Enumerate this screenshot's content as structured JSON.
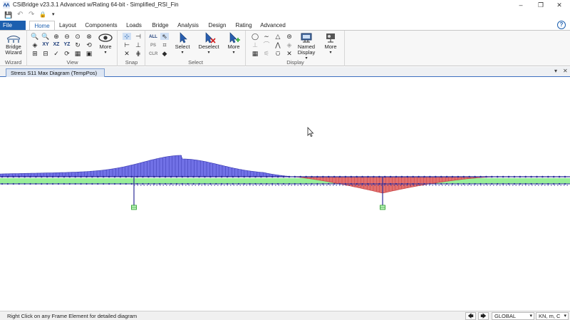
{
  "window": {
    "title": "CSiBridge v23.3.1 Advanced w/Rating 64-bit - Simplified_RSI_Fin",
    "minimize": "–",
    "restore": "❐",
    "close": "✕"
  },
  "quick_access": {
    "save": "💾",
    "undo": "↶",
    "redo": "↷",
    "lock": "🔒",
    "more": "▾"
  },
  "ribbon_tabs": {
    "file": "File",
    "items": [
      "Home",
      "Layout",
      "Components",
      "Loads",
      "Bridge",
      "Analysis",
      "Design",
      "Rating",
      "Advanced"
    ],
    "active": "Home",
    "help": "?"
  },
  "ribbon": {
    "bridge_wizard": {
      "label": "Bridge Wizard",
      "group": "Wizard"
    },
    "view": {
      "group": "View",
      "xy": "XY",
      "xz": "XZ",
      "yz": "YZ",
      "more": "More"
    },
    "snap": {
      "group": "Snap"
    },
    "select": {
      "group": "Select",
      "all": "ALL",
      "ps": "PS",
      "clr": "CLR",
      "select": "Select",
      "deselect": "Deselect",
      "more": "More"
    },
    "display": {
      "group": "Display",
      "named_display": "Named Display",
      "more": "More"
    }
  },
  "document": {
    "tab_title": "Stress S11 Max Diagram (TempPos)",
    "dropdown": "▾",
    "close": "✕"
  },
  "colors": {
    "positive": "#7171e6",
    "negative": "#e2706f",
    "deck": "#99ee99",
    "frame": "#2d2d9a",
    "file_tab": "#1c5faf"
  },
  "status": {
    "message": "Right Click on any Frame Element for detailed diagram",
    "nav_left": "🡄",
    "nav_right": "🡆",
    "coord_system": "GLOBAL",
    "units": "KN, m, C"
  }
}
